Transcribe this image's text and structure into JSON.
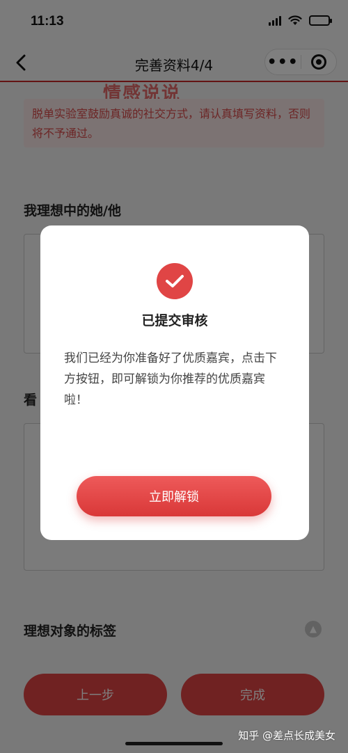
{
  "status_bar": {
    "time": "11:13"
  },
  "nav": {
    "title": "完善资料4/4",
    "back_icon": "chevron-left-icon",
    "more_icon": "more-dots-icon",
    "close_icon": "target-icon"
  },
  "page": {
    "watermark_top": "情感说说",
    "notice": "脱单实验室鼓励真诚的社交方式，请认真填写资料，否则将不予通过。",
    "ideal_partner_title": "我理想中的她/他",
    "second_section_title": "看",
    "tags_title": "理想对象的标签",
    "prev_button": "上一步",
    "finish_button": "完成"
  },
  "modal": {
    "check_icon": "check-icon",
    "title": "已提交审核",
    "body": "我们已经为你准备好了优质嘉宾，点击下方按钮，即可解锁为你推荐的优质嘉宾啦！",
    "unlock_button": "立即解锁"
  },
  "footer": {
    "credit": "知乎 @差点长成美女"
  },
  "colors": {
    "accent": "#e04545",
    "notice_bg": "#f9e6e6",
    "notice_text": "#d94a4a"
  }
}
